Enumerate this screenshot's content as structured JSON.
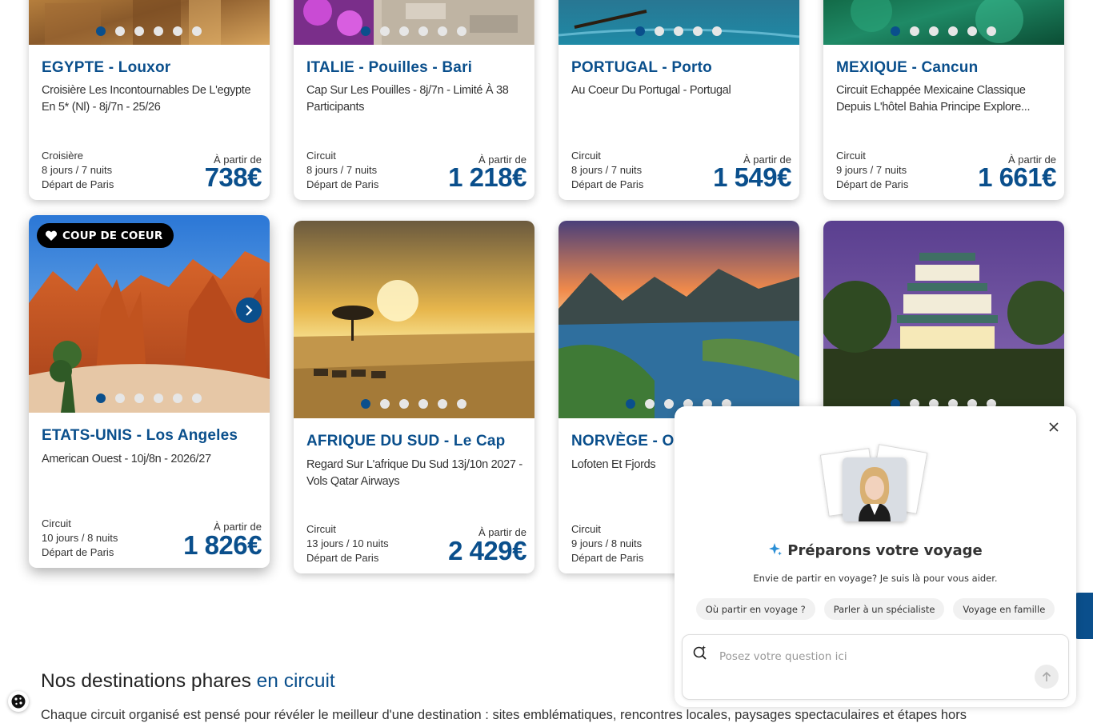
{
  "colors": {
    "brand_blue": "#0a4f8c",
    "dot_inactive": "#e6e6e6",
    "badge_bg": "#000000"
  },
  "cards": [
    {
      "country_city": "EGYPTE - Louxor",
      "description": "Croisière Les Incontournables De L'egypte En 5* (Nl) - 8j/7n - 25/26",
      "type": "Croisière",
      "duration": "8 jours / 7 nuits",
      "departure": "Départ de Paris",
      "from_label": "À partir de",
      "price": "738€",
      "carousel_dots": 6,
      "active_dot": 1
    },
    {
      "country_city": "ITALIE - Pouilles - Bari",
      "description": "Cap Sur Les Pouilles - 8j/7n - Limité À 38 Participants",
      "type": "Circuit",
      "duration": "8 jours / 7 nuits",
      "departure": "Départ de Paris",
      "from_label": "À partir de",
      "price": "1 218€",
      "carousel_dots": 6,
      "active_dot": 1
    },
    {
      "country_city": "PORTUGAL - Porto",
      "description": "Au Coeur Du Portugal - Portugal",
      "type": "Circuit",
      "duration": "8 jours / 7 nuits",
      "departure": "Départ de Paris",
      "from_label": "À partir de",
      "price": "1 549€",
      "carousel_dots": 5,
      "active_dot": 1
    },
    {
      "country_city": "MEXIQUE - Cancun",
      "description": "Circuit Echappée Mexicaine Classique Depuis L'hôtel Bahia Principe Explore...",
      "type": "Circuit",
      "duration": "9 jours / 7 nuits",
      "departure": "Départ de Paris",
      "from_label": "À partir de",
      "price": "1 661€",
      "carousel_dots": 6,
      "active_dot": 1
    },
    {
      "badge": "COUP DE COEUR",
      "country_city": "ETATS-UNIS - Los Angeles",
      "description": "American Ouest - 10j/8n - 2026/27",
      "type": "Circuit",
      "duration": "10 jours / 8 nuits",
      "departure": "Départ de Paris",
      "from_label": "À partir de",
      "price": "1 826€",
      "carousel_dots": 6,
      "active_dot": 1
    },
    {
      "country_city": "AFRIQUE DU SUD - Le Cap",
      "description": "Regard Sur L'afrique Du Sud 13j/10n 2027 - Vols Qatar Airways",
      "type": "Circuit",
      "duration": "13 jours / 10 nuits",
      "departure": "Départ de Paris",
      "from_label": "À partir de",
      "price": "2 429€",
      "carousel_dots": 6,
      "active_dot": 1
    },
    {
      "country_city": "NORVÈGE - Os",
      "description": "Lofoten Et Fjords",
      "type": "Circuit",
      "duration": "9 jours / 8 nuits",
      "departure": "Départ de Paris",
      "carousel_dots": 6,
      "active_dot": 1
    },
    {
      "carousel_dots": 6,
      "active_dot": 1
    }
  ],
  "section": {
    "title": "Nos destinations phares ",
    "title_accent": "en circuit",
    "intro": "Chaque circuit organisé est pensé pour révéler le meilleur d'une destination : sites emblématiques, rencontres locales, paysages spectaculaires et étapes hors"
  },
  "chat": {
    "title": "Préparons votre voyage",
    "subtitle": "Envie de partir en voyage? Je suis là pour vous aider.",
    "chips": [
      "Où partir en voyage ?",
      "Parler à un spécialiste",
      "Voyage en famille"
    ],
    "input_placeholder": "Posez votre question ici"
  },
  "icons": {
    "close": "close-icon",
    "sparkle": "sparkle-icon",
    "ai_search": "ai-search-icon",
    "send": "arrow-up-icon",
    "cookie": "cookie-icon",
    "heart": "heart-icon",
    "next": "chevron-right-icon"
  }
}
